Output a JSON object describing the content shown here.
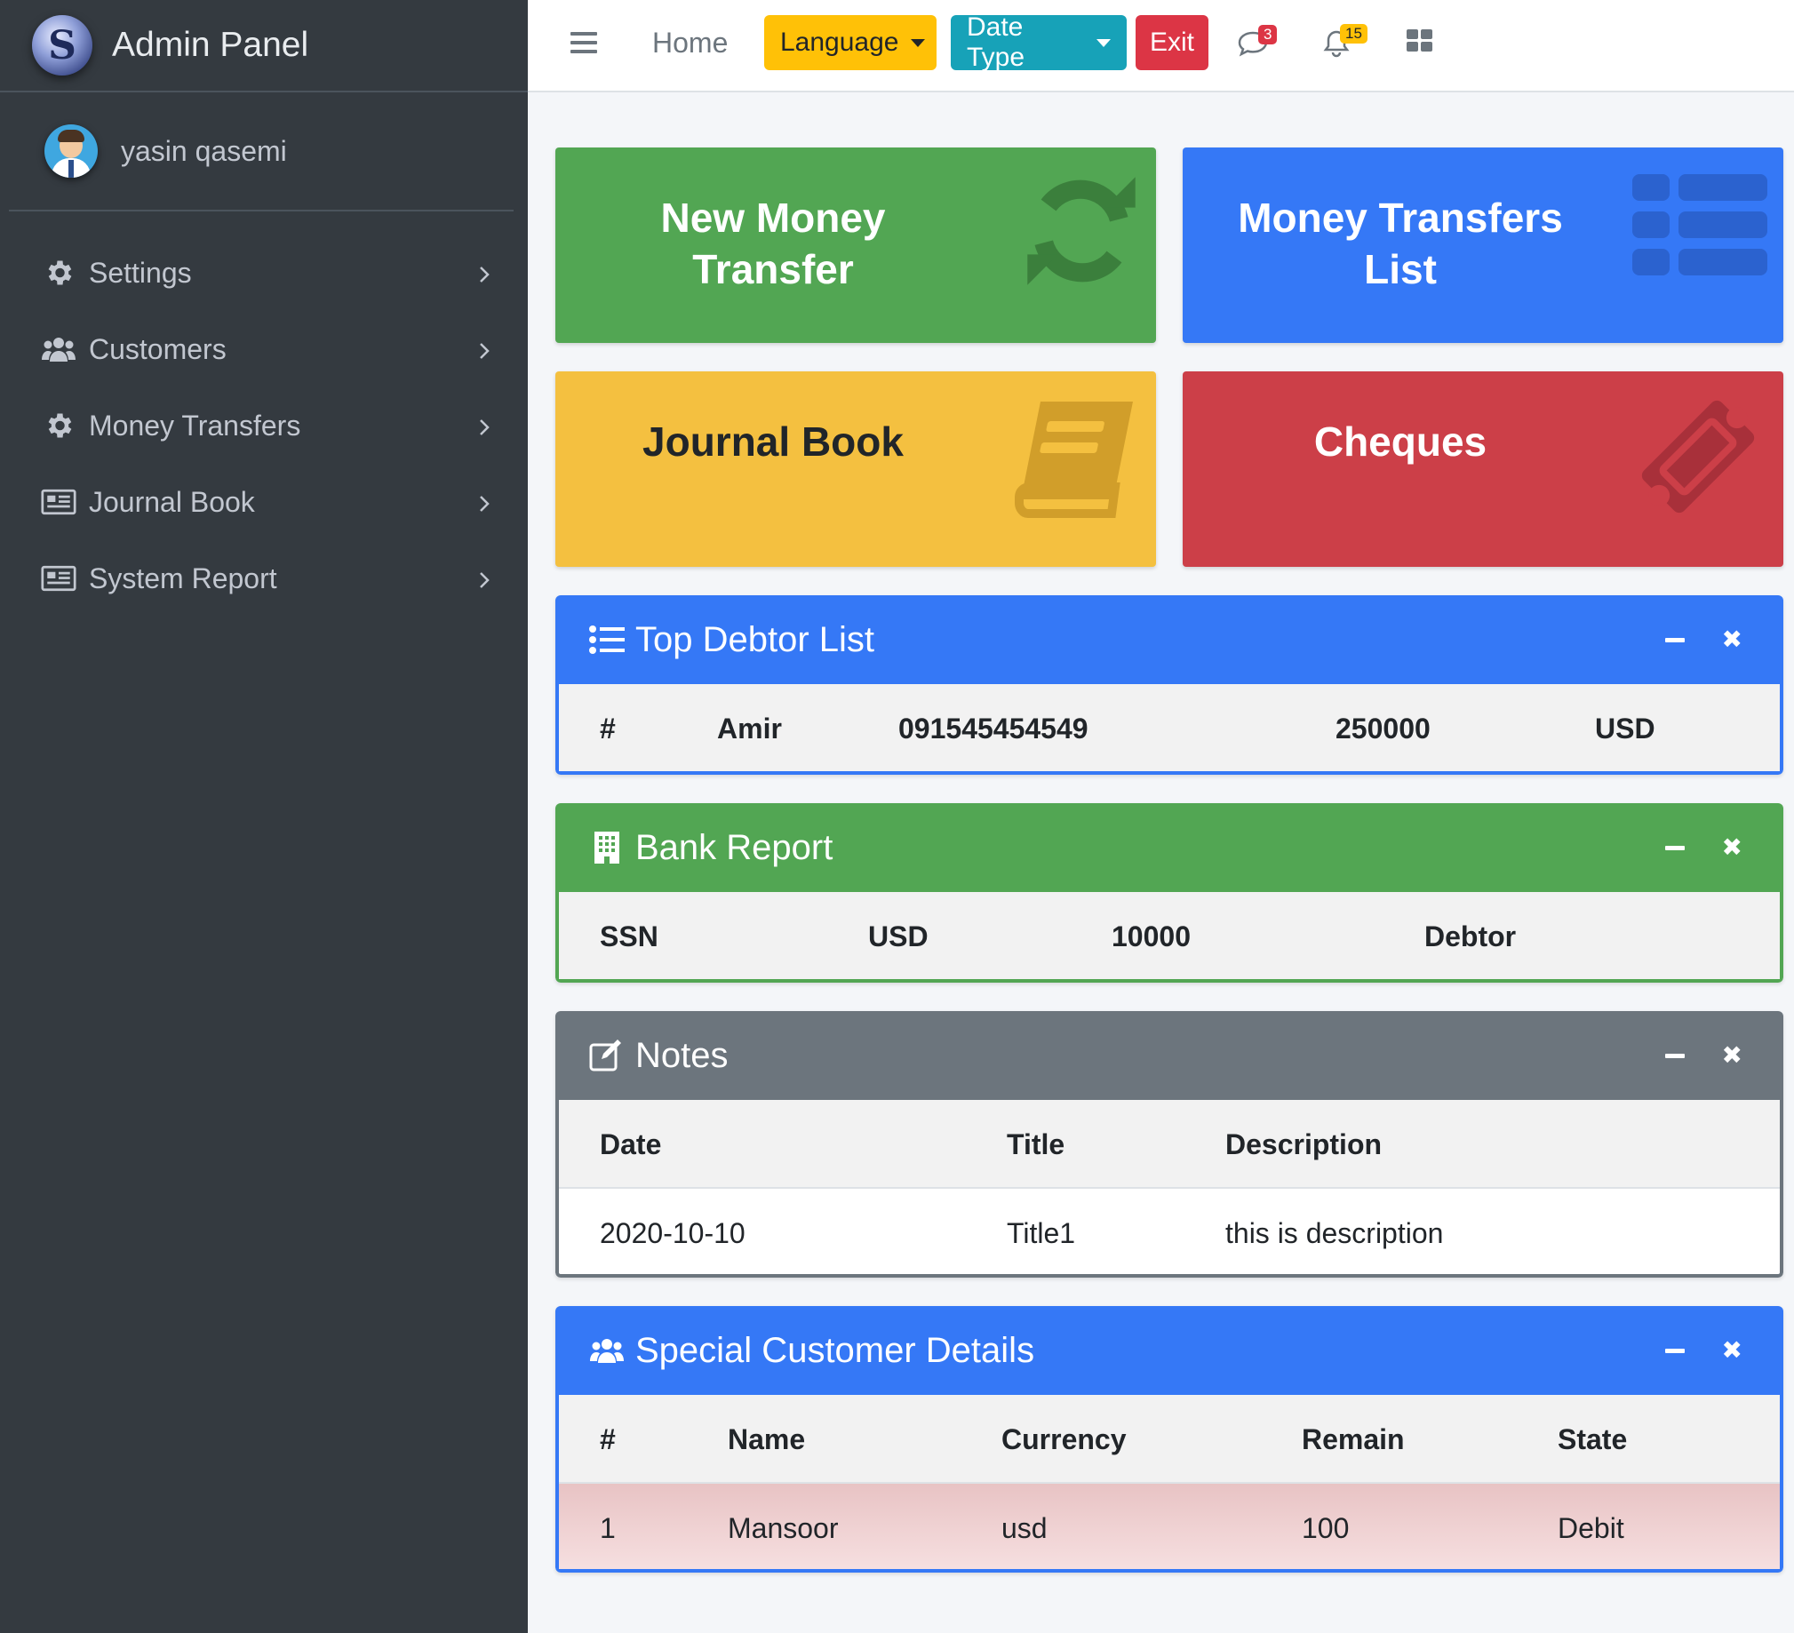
{
  "brand": {
    "title": "Admin Panel",
    "logo_icon": "s-logo-icon"
  },
  "user": {
    "name": "yasin qasemi"
  },
  "sidebar": {
    "items": [
      {
        "label": "Settings",
        "icon": "gear-icon"
      },
      {
        "label": "Customers",
        "icon": "users-icon"
      },
      {
        "label": "Money Transfers",
        "icon": "gear-icon"
      },
      {
        "label": "Journal Book",
        "icon": "newspaper-icon"
      },
      {
        "label": "System Report",
        "icon": "newspaper-icon"
      }
    ]
  },
  "topbar": {
    "home": "Home",
    "language": "Language",
    "date_type": "Date Type",
    "exit": "Exit",
    "messages_count": "3",
    "notifications_count": "15"
  },
  "tiles": {
    "new_transfer": "New Money Transfer",
    "transfers_list": "Money Transfers List",
    "journal_book": "Journal Book",
    "cheques": "Cheques"
  },
  "colors": {
    "green": "#52a653",
    "blue": "#3578f6",
    "yellow": "#f4c040",
    "red": "#cc3f48",
    "gray": "#6c757d",
    "sidebar": "#343a40"
  },
  "top_debtor": {
    "title": "Top Debtor List",
    "row": {
      "num": "#",
      "name": "Amir",
      "phone": "091545454549",
      "amount": "250000",
      "currency": "USD"
    }
  },
  "bank_report": {
    "title": "Bank Report",
    "row": {
      "ssn": "SSN",
      "currency": "USD",
      "amount": "10000",
      "state": "Debtor"
    }
  },
  "notes": {
    "title": "Notes",
    "headers": {
      "date": "Date",
      "title": "Title",
      "description": "Description"
    },
    "rows": [
      {
        "date": "2020-10-10",
        "title": "Title1",
        "description": "this is description"
      }
    ]
  },
  "special_customers": {
    "title": "Special Customer Details",
    "headers": {
      "num": "#",
      "name": "Name",
      "currency": "Currency",
      "remain": "Remain",
      "state": "State"
    },
    "rows": [
      {
        "num": "1",
        "name": "Mansoor",
        "currency": "usd",
        "remain": "100",
        "state": "Debit"
      }
    ]
  }
}
